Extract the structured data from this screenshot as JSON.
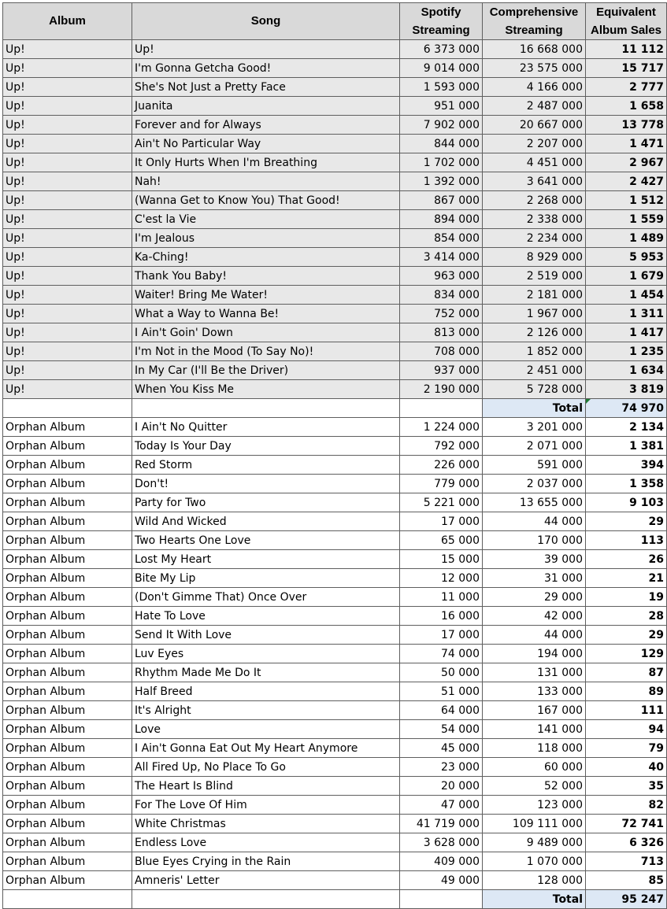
{
  "headers": {
    "album": "Album",
    "song": "Song",
    "spotify": [
      "Spotify",
      "Streaming"
    ],
    "comprehensive": [
      "Comprehensive",
      "Streaming"
    ],
    "equivalent": [
      "Equivalent",
      "Album Sales"
    ]
  },
  "groups": [
    {
      "rows": [
        [
          "Up!",
          "Up!",
          "6 373 000",
          "16 668 000",
          "11 112"
        ],
        [
          "Up!",
          "I'm Gonna Getcha Good!",
          "9 014 000",
          "23 575 000",
          "15 717"
        ],
        [
          "Up!",
          "She's Not Just a Pretty Face",
          "1 593 000",
          "4 166 000",
          "2 777"
        ],
        [
          "Up!",
          "Juanita",
          "951 000",
          "2 487 000",
          "1 658"
        ],
        [
          "Up!",
          "Forever and for Always",
          "7 902 000",
          "20 667 000",
          "13 778"
        ],
        [
          "Up!",
          "Ain't No Particular Way",
          "844 000",
          "2 207 000",
          "1 471"
        ],
        [
          "Up!",
          "It Only Hurts When I'm Breathing",
          "1 702 000",
          "4 451 000",
          "2 967"
        ],
        [
          "Up!",
          "Nah!",
          "1 392 000",
          "3 641 000",
          "2 427"
        ],
        [
          "Up!",
          "(Wanna Get to Know You) That Good!",
          "867 000",
          "2 268 000",
          "1 512"
        ],
        [
          "Up!",
          "C'est la Vie",
          "894 000",
          "2 338 000",
          "1 559"
        ],
        [
          "Up!",
          "I'm Jealous",
          "854 000",
          "2 234 000",
          "1 489"
        ],
        [
          "Up!",
          "Ka-Ching!",
          "3 414 000",
          "8 929 000",
          "5 953"
        ],
        [
          "Up!",
          "Thank You Baby!",
          "963 000",
          "2 519 000",
          "1 679"
        ],
        [
          "Up!",
          "Waiter! Bring Me Water!",
          "834 000",
          "2 181 000",
          "1 454"
        ],
        [
          "Up!",
          "What a Way to Wanna Be!",
          "752 000",
          "1 967 000",
          "1 311"
        ],
        [
          "Up!",
          "I Ain't Goin' Down",
          "813 000",
          "2 126 000",
          "1 417"
        ],
        [
          "Up!",
          "I'm Not in the Mood (To Say No)!",
          "708 000",
          "1 852 000",
          "1 235"
        ],
        [
          "Up!",
          "In My Car (I'll Be the Driver)",
          "937 000",
          "2 451 000",
          "1 634"
        ],
        [
          "Up!",
          "When You Kiss Me",
          "2 190 000",
          "5 728 000",
          "3 819"
        ]
      ],
      "total_label": "Total",
      "total_value": "74 970"
    },
    {
      "rows": [
        [
          "Orphan Album",
          "I Ain't No Quitter",
          "1 224 000",
          "3 201 000",
          "2 134"
        ],
        [
          "Orphan Album",
          "Today Is Your Day",
          "792 000",
          "2 071 000",
          "1 381"
        ],
        [
          "Orphan Album",
          "Red Storm",
          "226 000",
          "591 000",
          "394"
        ],
        [
          "Orphan Album",
          "Don't!",
          "779 000",
          "2 037 000",
          "1 358"
        ],
        [
          "Orphan Album",
          "Party for Two",
          "5 221 000",
          "13 655 000",
          "9 103"
        ],
        [
          "Orphan Album",
          "Wild And Wicked",
          "17 000",
          "44 000",
          "29"
        ],
        [
          "Orphan Album",
          "Two Hearts One Love",
          "65 000",
          "170 000",
          "113"
        ],
        [
          "Orphan Album",
          "Lost My Heart",
          "15 000",
          "39 000",
          "26"
        ],
        [
          "Orphan Album",
          "Bite My Lip",
          "12 000",
          "31 000",
          "21"
        ],
        [
          "Orphan Album",
          "(Don't Gimme That) Once Over",
          "11 000",
          "29 000",
          "19"
        ],
        [
          "Orphan Album",
          "Hate To Love",
          "16 000",
          "42 000",
          "28"
        ],
        [
          "Orphan Album",
          "Send It With Love",
          "17 000",
          "44 000",
          "29"
        ],
        [
          "Orphan Album",
          "Luv Eyes",
          "74 000",
          "194 000",
          "129"
        ],
        [
          "Orphan Album",
          "Rhythm Made Me Do It",
          "50 000",
          "131 000",
          "87"
        ],
        [
          "Orphan Album",
          "Half Breed",
          "51 000",
          "133 000",
          "89"
        ],
        [
          "Orphan Album",
          "It's Alright",
          "64 000",
          "167 000",
          "111"
        ],
        [
          "Orphan Album",
          "Love",
          "54 000",
          "141 000",
          "94"
        ],
        [
          "Orphan Album",
          "I Ain't Gonna Eat Out My Heart Anymore",
          "45 000",
          "118 000",
          "79"
        ],
        [
          "Orphan Album",
          "All Fired Up, No Place To Go",
          "23 000",
          "60 000",
          "40"
        ],
        [
          "Orphan Album",
          "The Heart Is Blind",
          "20 000",
          "52 000",
          "35"
        ],
        [
          "Orphan Album",
          "For The Love Of Him",
          "47 000",
          "123 000",
          "82"
        ],
        [
          "Orphan Album",
          "White Christmas",
          "41 719 000",
          "109 111 000",
          "72 741"
        ],
        [
          "Orphan Album",
          "Endless Love",
          "3 628 000",
          "9 489 000",
          "6 326"
        ],
        [
          "Orphan Album",
          "Blue Eyes Crying in the Rain",
          "409 000",
          "1 070 000",
          "713"
        ],
        [
          "Orphan Album",
          "Amneris' Letter",
          "49 000",
          "128 000",
          "85"
        ]
      ],
      "total_label": "Total",
      "total_value": "95 247"
    }
  ]
}
